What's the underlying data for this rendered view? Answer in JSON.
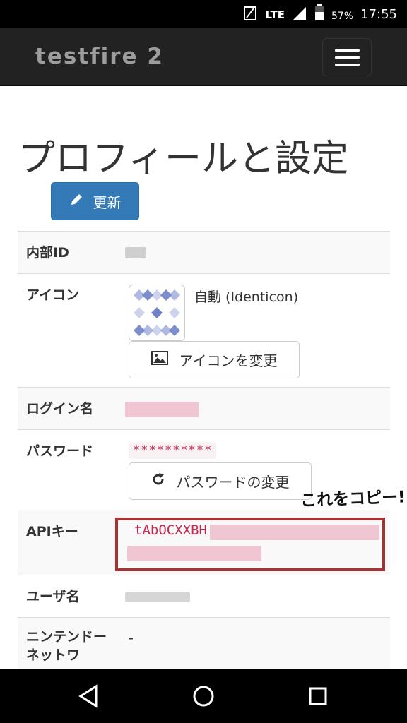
{
  "status": {
    "network": "LTE",
    "battery": "57%",
    "time": "17:55"
  },
  "navbar": {
    "brand": "testfire 2"
  },
  "page": {
    "title": "プロフィールと設定",
    "update_button": "更新"
  },
  "profile": {
    "rows": [
      {
        "label": "内部ID"
      },
      {
        "label": "アイコン",
        "value": "自動 (Identicon)",
        "button": "アイコンを変更"
      },
      {
        "label": "ログイン名"
      },
      {
        "label": "パスワード",
        "value": "**********",
        "button": "パスワードの変更"
      },
      {
        "label": "APIキー",
        "value": "tAbOCXXBH"
      },
      {
        "label": "ユーザ名"
      },
      {
        "label": "ニンテンドーネットワ",
        "value": "-"
      }
    ]
  },
  "annotation": "これをコピー!",
  "colors": {
    "primary": "#337ab7",
    "navbar": "#222222",
    "code": "#c7254e",
    "highlight_box": "#a83232"
  }
}
